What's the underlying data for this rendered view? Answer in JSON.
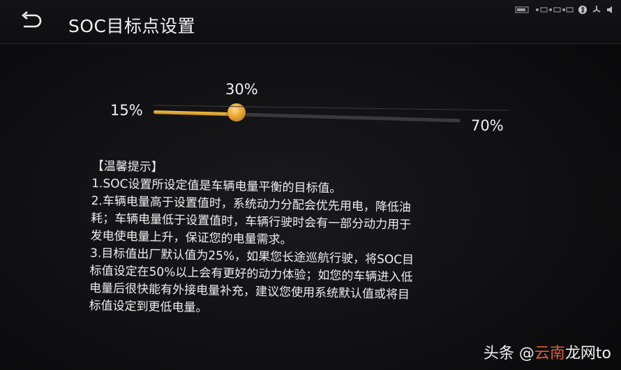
{
  "header": {
    "title": "SOC目标点设置"
  },
  "status_bar": {
    "icons": [
      "battery-indicator-icon",
      "signal-indicator-icon",
      "bluetooth-icon",
      "fan-icon",
      "volume-icon"
    ]
  },
  "slider": {
    "min_label": "15%",
    "current_label": "30%",
    "max_label": "70%",
    "value": 30,
    "min": 15,
    "max": 70,
    "fill_color": "#e7a630"
  },
  "notes": {
    "heading": "【温馨提示】",
    "lines": [
      "1.SOC设置所设定值是车辆电量平衡的目标值。",
      "2.车辆电量高于设置值时，系统动力分配会优先用电，降低油",
      "耗；车辆电量低于设置值时，车辆行驶时会有一部分动力用于",
      "发电使电量上升，保证您的电量需求。",
      "3.目标值出厂默认值为25%，如果您长途巡航行驶，将SOC目",
      "标值设定在50%以上会有更好的动力体验；如您的车辆进入低",
      "电量后很快能有外接电量补充，建议您使用系统默认值或将目",
      "标值设定到更低电量。"
    ]
  },
  "watermark": {
    "prefix": "头条 @",
    "accent": "云南",
    "suffix": "龙网to"
  }
}
